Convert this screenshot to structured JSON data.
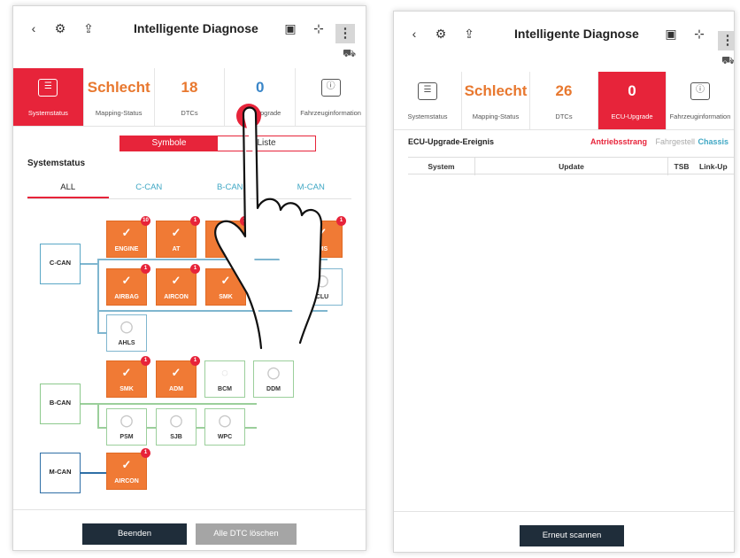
{
  "left": {
    "title": "Intelligente Diagnose",
    "status": {
      "systemstatus_label": "Systemstatus",
      "mapping_value": "Schlecht",
      "mapping_label": "Mapping-Status",
      "dtc_value": "18",
      "dtc_label": "DTCs",
      "ecu_value": "0",
      "ecu_label": "ECU-Upgrade",
      "vehicle_label": "Fahrzeuginformation"
    },
    "view_toggle": {
      "symbols": "Symbole",
      "list": "Liste"
    },
    "section": "Systemstatus",
    "tabs": [
      "ALL",
      "C-CAN",
      "B-CAN",
      "M-CAN"
    ],
    "buses": {
      "c": "C-CAN",
      "b": "B-CAN",
      "m": "M-CAN"
    },
    "ecus": {
      "engine": {
        "name": "ENGINE",
        "badge": "10"
      },
      "at": {
        "name": "AT",
        "badge": "1"
      },
      "c3": {
        "name": "",
        "badge": "1"
      },
      "ims": {
        "name": "IMS",
        "badge": "1"
      },
      "airbag": {
        "name": "AIRBAG",
        "badge": "1"
      },
      "aircon": {
        "name": "AIRCON",
        "badge": "1"
      },
      "smk_c": {
        "name": "SMK",
        "badge": "1"
      },
      "clu": {
        "name": "CLU"
      },
      "ahls": {
        "name": "AHLS"
      },
      "smk_b": {
        "name": "SMK",
        "badge": "1"
      },
      "adm": {
        "name": "ADM",
        "badge": "1"
      },
      "bcm": {
        "name": "BCM"
      },
      "ddm": {
        "name": "DDM"
      },
      "psm": {
        "name": "PSM"
      },
      "sjb": {
        "name": "SJB"
      },
      "wpc": {
        "name": "WPC"
      },
      "aircon_m": {
        "name": "AIRCON",
        "badge": "1"
      }
    },
    "buttons": {
      "end": "Beenden",
      "clear": "Alle DTC löschen"
    }
  },
  "right": {
    "title": "Intelligente Diagnose",
    "status": {
      "systemstatus_label": "Systemstatus",
      "mapping_value": "Schlecht",
      "mapping_label": "Mapping-Status",
      "dtc_value": "26",
      "dtc_label": "DTCs",
      "ecu_value": "0",
      "ecu_label": "ECU-Upgrade",
      "vehicle_label": "Fahrzeuginformation"
    },
    "event_title": "ECU-Upgrade-Ereignis",
    "filters": [
      "Antriebsstrang",
      "Fahrgestell",
      "Chassis"
    ],
    "columns": [
      "System",
      "Update",
      "TSB",
      "Link-Up"
    ],
    "rescan": "Erneut scannen"
  },
  "colors": {
    "accent": "#e7243a",
    "orange": "#f07a35",
    "cyan": "#3fa7c4",
    "dark_button": "#1f2d3a"
  },
  "icons": [
    "back-arrow-icon",
    "gear-car-icon",
    "upload-icon",
    "ecu-chip-icon",
    "expand-icon",
    "more-menu-icon",
    "car-icon",
    "list-check-icon",
    "vehicle-info-icon",
    "checkmark-icon",
    "hand-pointer-icon"
  ]
}
